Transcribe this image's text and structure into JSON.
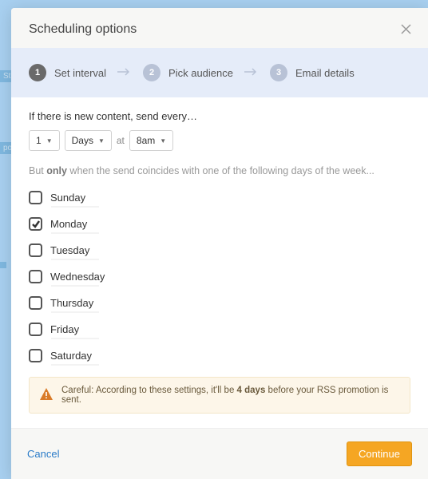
{
  "modal": {
    "title": "Scheduling options"
  },
  "steps": [
    {
      "num": "1",
      "label": "Set interval",
      "active": true
    },
    {
      "num": "2",
      "label": "Pick audience",
      "active": false
    },
    {
      "num": "3",
      "label": "Email details",
      "active": false
    }
  ],
  "intro": "If there is new content, send every…",
  "interval": {
    "count": "1",
    "unit": "Days",
    "at_label": "at",
    "time": "8am"
  },
  "only_line_prefix": "But ",
  "only_line_bold": "only",
  "only_line_suffix": " when the send coincides with one of the following days of the week...",
  "days": [
    {
      "label": "Sunday",
      "checked": false
    },
    {
      "label": "Monday",
      "checked": true
    },
    {
      "label": "Tuesday",
      "checked": false
    },
    {
      "label": "Wednesday",
      "checked": false
    },
    {
      "label": "Thursday",
      "checked": false
    },
    {
      "label": "Friday",
      "checked": false
    },
    {
      "label": "Saturday",
      "checked": false
    }
  ],
  "warning": {
    "prefix": "Careful: According to these settings, it'll be ",
    "bold": "4 days",
    "suffix": " before your RSS promotion is sent."
  },
  "footer": {
    "cancel": "Cancel",
    "continue": "Continue"
  }
}
